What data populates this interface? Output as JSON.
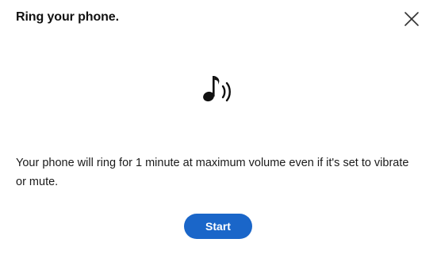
{
  "dialog": {
    "title": "Ring your phone.",
    "message": "Your phone will ring for 1 minute at maximum volume even if it's set to vibrate or mute.",
    "start_label": "Start",
    "icons": {
      "close": "close-icon",
      "ring": "music-note-sound-icon"
    },
    "colors": {
      "primary_button": "#1a66c9",
      "text": "#1a1a1a"
    }
  }
}
